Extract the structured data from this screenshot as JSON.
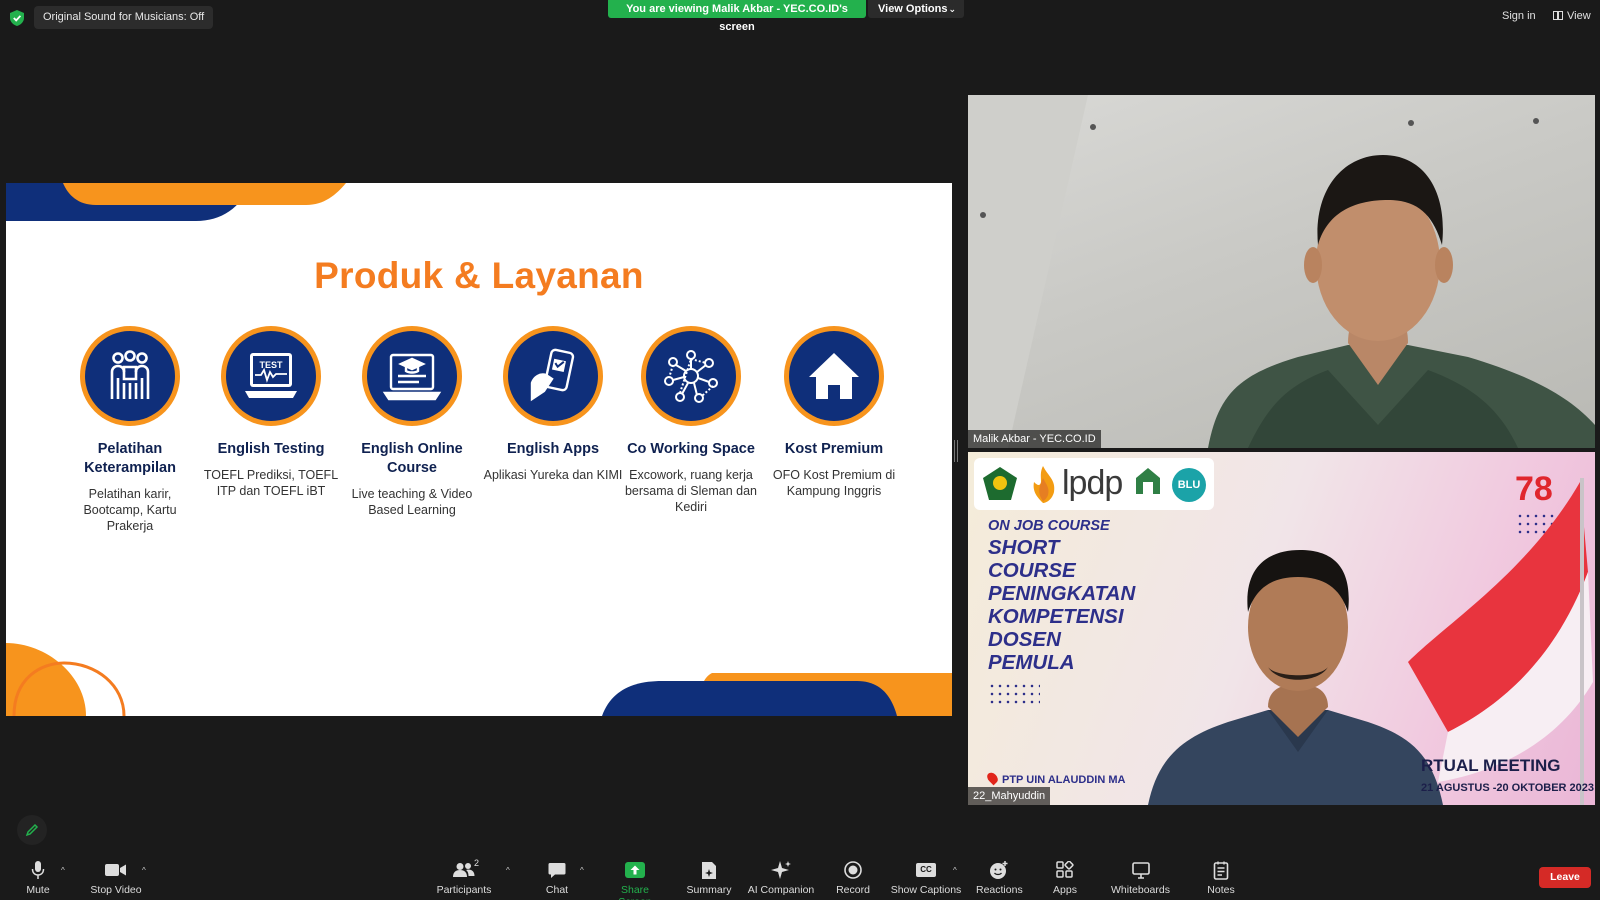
{
  "top_bar": {
    "original_sound": "Original Sound for Musicians: Off",
    "viewing_banner": "You are viewing Malik Akbar - YEC.CO.ID's screen",
    "view_options": "View Options",
    "sign_in": "Sign in",
    "view": "View"
  },
  "slide": {
    "title": "Produk & Layanan",
    "products": [
      {
        "name": "Pelatihan Keterampilan",
        "desc": "Pelatihan karir, Bootcamp, Kartu Prakerja",
        "icon": "people-training-icon"
      },
      {
        "name": "English Testing",
        "desc": "TOEFL Prediksi, TOEFL ITP dan TOEFL iBT",
        "icon": "test-monitor-icon"
      },
      {
        "name": "English Online Course",
        "desc": "Live teaching & Video Based Learning",
        "icon": "laptop-graduation-icon"
      },
      {
        "name": "English Apps",
        "desc": "Aplikasi Yureka dan KIMI",
        "icon": "phone-hand-icon"
      },
      {
        "name": "Co Working Space",
        "desc": "Excowork, ruang kerja bersama di Sleman dan Kediri",
        "icon": "network-people-icon"
      },
      {
        "name": "Kost Premium",
        "desc": "OFO Kost Premium di Kampung Inggris",
        "icon": "house-icon"
      }
    ]
  },
  "participants": {
    "tile1_name": "Malik Akbar - YEC.CO.ID",
    "tile2_name": "22_Mahyuddin"
  },
  "background_slide": {
    "logo_text": "lpdp",
    "blu": "BLU",
    "on_job_course": "ON JOB COURSE",
    "course_lines": [
      "SHORT",
      "COURSE",
      "PENINGKATAN",
      "KOMPETENSI",
      "DOSEN",
      "PEMULA"
    ],
    "location": "PTP UIN ALAUDDIN MA",
    "virtual_meeting": "RTUAL MEETING",
    "dates": "21 AGUSTUS -20 OKTOBER 2023",
    "anniversary": "78"
  },
  "toolbar": {
    "mute": "Mute",
    "stop_video": "Stop Video",
    "participants": "Participants",
    "participants_count": "2",
    "chat": "Chat",
    "share_screen": "Share Screen",
    "summary": "Summary",
    "ai_companion": "AI Companion",
    "record": "Record",
    "show_captions": "Show Captions",
    "captions_icon_text": "CC",
    "reactions": "Reactions",
    "apps": "Apps",
    "whiteboards": "Whiteboards",
    "notes": "Notes",
    "leave": "Leave"
  },
  "colors": {
    "accent_orange": "#f47c20",
    "navy": "#0f2f7a",
    "share_green": "#23b14d",
    "leave_red": "#d52a26"
  }
}
